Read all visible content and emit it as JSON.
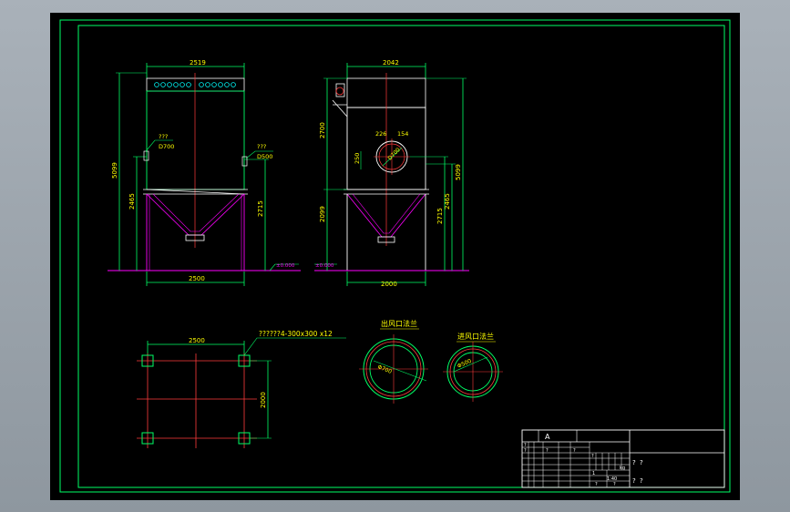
{
  "colors": {
    "paper": "#000000",
    "border": "#00ff00",
    "frame": "#00ffff",
    "center": "#ff3b3b",
    "structure": "#ffffff",
    "hopper": "#ff00ff",
    "dimension": "#00ff00",
    "text_yellow": "#ffff00",
    "text_green": "#00ff00"
  },
  "front_view": {
    "width_top": "2519",
    "width_bottom": "2500",
    "height_total": "5099",
    "height_inlet": "2465",
    "height_leg": "2715",
    "inlet_label": "???",
    "inlet_size": "D700",
    "outlet_label": "???",
    "outlet_size": "D500",
    "ground_label": "±0.000"
  },
  "side_view": {
    "width_top": "2042",
    "width_bottom": "2000",
    "height_top": "2700",
    "height_total": "5099",
    "height_inlet": "2465",
    "height_leg": "2715",
    "height_left": "2099",
    "dim_a": "226",
    "dim_b": "154",
    "dim_c": "250",
    "flange_size": "D700",
    "ground_label": "±0.000"
  },
  "plan_view": {
    "width": "2500",
    "depth": "2000",
    "anchor_label": "??????4-300x300 x12"
  },
  "flanges": {
    "inlet_title": "出风口法兰",
    "inlet_size": "Φ700",
    "outlet_title": "进风口法兰",
    "outlet_size": "Φ500"
  },
  "title_block": {
    "rev": "A",
    "r1": "?",
    "r2": "?",
    "r3": "?",
    "qmark1": "?",
    "qmark2": "?",
    "qmark3": "?",
    "qmark4": "?",
    "kg": "kg",
    "scale": "1:40",
    "count": "1",
    "seal1": "?",
    "seal2": "?",
    "seal3": "?",
    "seal4": "?"
  }
}
